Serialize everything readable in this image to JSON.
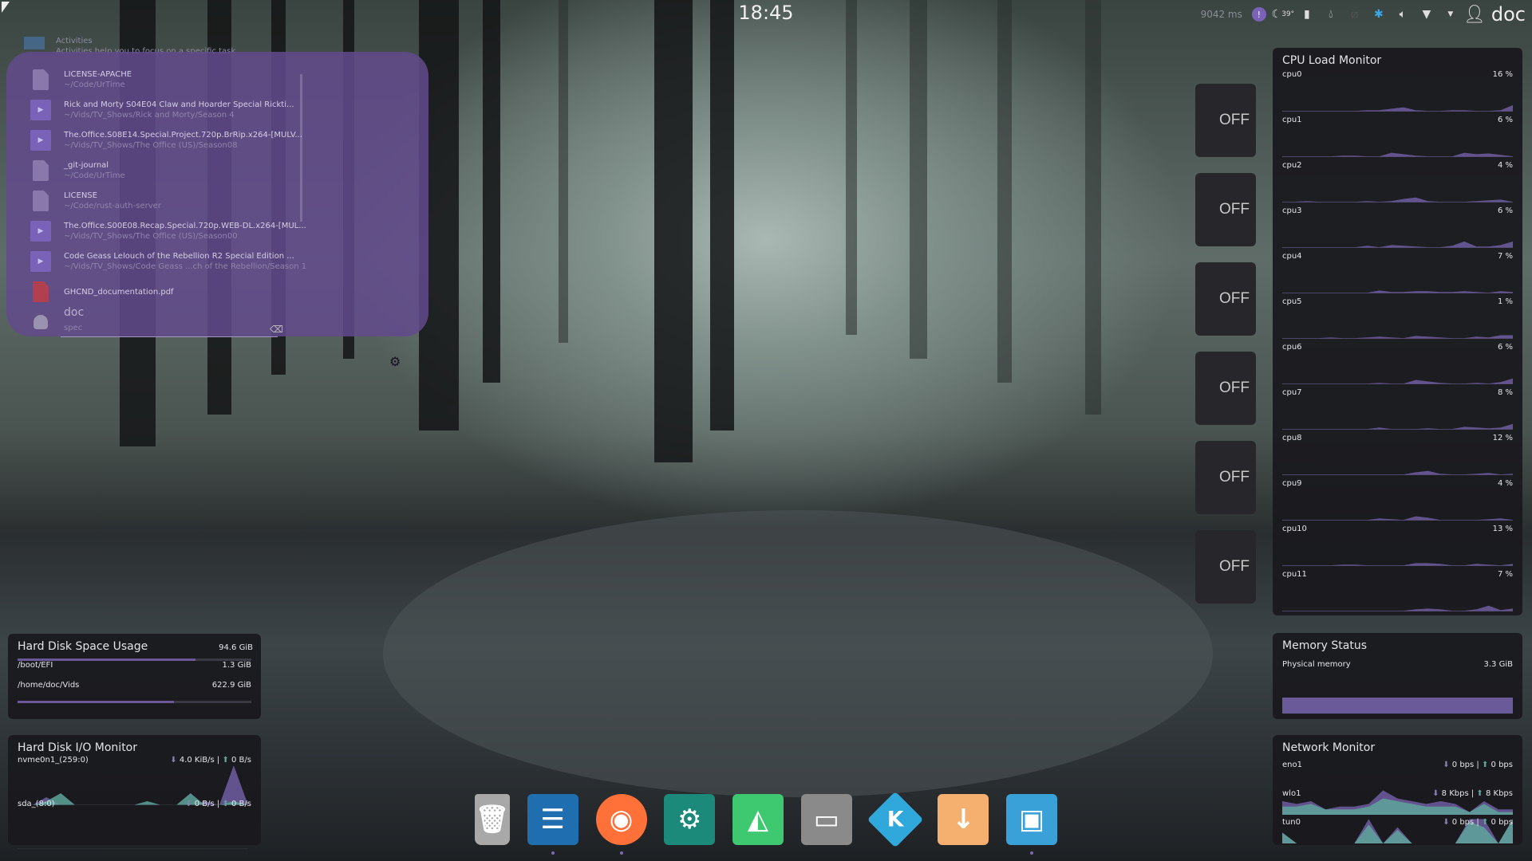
{
  "topbar": {
    "clock": "18:45",
    "latency": "9042 ms",
    "temperature": "39°",
    "user": "doc",
    "tray_icons": [
      "notification-icon",
      "weather-icon",
      "battery-icon",
      "ink-drop-icon",
      "disabled-icon",
      "bluetooth-icon",
      "volume-icon",
      "wifi-icon",
      "expand-arrow-icon",
      "user-icon"
    ]
  },
  "launcher": {
    "activities": {
      "title": "Activities",
      "subtitle": "Activities help you to focus on a specific task"
    },
    "items": [
      {
        "title": "LICENSE-APACHE",
        "path": "~/Code/UrTime",
        "type": "doc"
      },
      {
        "title": "Rick and Morty S04E04 Claw and Hoarder Special Rickti...",
        "path": "~/Vids/TV_Shows/Rick and Morty/Season 4",
        "type": "vid"
      },
      {
        "title": "The.Office.S08E14.Special.Project.720p.BrRip.x264-[MULV...",
        "path": "~/Vids/TV_Shows/The Office (US)/Season08",
        "type": "vid"
      },
      {
        "title": "_git-journal",
        "path": "~/Code/UrTime",
        "type": "doc"
      },
      {
        "title": "LICENSE",
        "path": "~/Code/rust-auth-server",
        "type": "doc"
      },
      {
        "title": "The.Office.S00E08.Recap.Special.720p.WEB-DL.x264-[MUL...",
        "path": "~/Vids/TV_Shows/The Office (US)/Season00",
        "type": "vid"
      },
      {
        "title": "Code Geass Lelouch of the Rebellion R2 Special Edition ...",
        "path": "~/Vids/TV_Shows/Code Geass ...ch of the Rebellion/Season 1",
        "type": "vid"
      },
      {
        "title": "GHCND_documentation.pdf",
        "path": "",
        "type": "pdf"
      }
    ],
    "user": "doc",
    "search_value": "spec"
  },
  "switches": [
    "OFF",
    "OFF",
    "OFF",
    "OFF",
    "OFF",
    "OFF"
  ],
  "cpu": {
    "title": "CPU Load Monitor",
    "cores": [
      {
        "name": "cpu0",
        "value": "16 %",
        "history": [
          1,
          1,
          1,
          1,
          1,
          1,
          1,
          2,
          2,
          4,
          6,
          2,
          1,
          1,
          2,
          2,
          1,
          1,
          2,
          9
        ]
      },
      {
        "name": "cpu1",
        "value": "6 %",
        "history": [
          1,
          1,
          1,
          1,
          1,
          2,
          2,
          1,
          1,
          6,
          4,
          2,
          1,
          1,
          1,
          6,
          4,
          5,
          3,
          1
        ]
      },
      {
        "name": "cpu2",
        "value": "4 %",
        "history": [
          1,
          1,
          2,
          1,
          1,
          1,
          1,
          2,
          1,
          2,
          5,
          7,
          2,
          1,
          1,
          1,
          2,
          3,
          4,
          1
        ]
      },
      {
        "name": "cpu3",
        "value": "6 %",
        "history": [
          1,
          1,
          1,
          1,
          1,
          1,
          1,
          3,
          1,
          4,
          3,
          2,
          1,
          1,
          3,
          9,
          2,
          2,
          4,
          9
        ]
      },
      {
        "name": "cpu4",
        "value": "7 %",
        "history": [
          1,
          1,
          1,
          1,
          1,
          1,
          1,
          1,
          4,
          2,
          2,
          3,
          3,
          2,
          2,
          3,
          2,
          1,
          3,
          2
        ]
      },
      {
        "name": "cpu5",
        "value": "1 %",
        "history": [
          1,
          1,
          1,
          1,
          2,
          1,
          1,
          2,
          3,
          2,
          1,
          4,
          3,
          2,
          1,
          1,
          3,
          2,
          5,
          5
        ]
      },
      {
        "name": "cpu6",
        "value": "6 %",
        "history": [
          1,
          1,
          1,
          1,
          1,
          1,
          1,
          1,
          2,
          1,
          1,
          6,
          4,
          2,
          1,
          1,
          2,
          1,
          3,
          8
        ]
      },
      {
        "name": "cpu7",
        "value": "8 %",
        "history": [
          1,
          1,
          1,
          1,
          1,
          1,
          1,
          1,
          3,
          1,
          1,
          1,
          2,
          1,
          1,
          4,
          3,
          2,
          3,
          8
        ]
      },
      {
        "name": "cpu8",
        "value": "12 %",
        "history": [
          1,
          1,
          1,
          1,
          1,
          1,
          1,
          1,
          1,
          1,
          1,
          4,
          6,
          2,
          1,
          1,
          2,
          3,
          1,
          2
        ]
      },
      {
        "name": "cpu9",
        "value": "4 %",
        "history": [
          1,
          1,
          1,
          1,
          1,
          1,
          1,
          1,
          3,
          2,
          1,
          6,
          4,
          1,
          1,
          1,
          1,
          2,
          3,
          1
        ]
      },
      {
        "name": "cpu10",
        "value": "13 %",
        "history": [
          1,
          1,
          1,
          1,
          1,
          2,
          2,
          1,
          1,
          1,
          1,
          4,
          4,
          3,
          1,
          1,
          3,
          2,
          1,
          3
        ]
      },
      {
        "name": "cpu11",
        "value": "7 %",
        "history": [
          1,
          1,
          1,
          1,
          1,
          1,
          1,
          1,
          1,
          1,
          1,
          3,
          4,
          3,
          1,
          1,
          3,
          8,
          2,
          4
        ]
      }
    ]
  },
  "memory": {
    "title": "Memory Status",
    "label": "Physical memory",
    "value": "3.3 GiB",
    "fraction": 1.0
  },
  "network": {
    "title": "Network Monitor",
    "interfaces": [
      {
        "name": "eno1",
        "down": "0 bps",
        "up": "0 bps",
        "down_hist": [
          0,
          0,
          0,
          0,
          0,
          0,
          0,
          0,
          0,
          0
        ],
        "up_hist": [
          0,
          0,
          0,
          0,
          0,
          0,
          0,
          0,
          0,
          0
        ]
      },
      {
        "name": "wlo1",
        "down": "8 Kbps",
        "up": "8 Kbps",
        "down_hist": [
          5,
          4,
          5,
          2,
          3,
          3,
          4,
          9,
          6,
          5,
          4,
          5,
          4,
          1,
          5,
          2,
          2
        ],
        "up_hist": [
          3,
          3,
          4,
          2,
          2,
          2,
          3,
          6,
          5,
          4,
          3,
          3,
          3,
          1,
          4,
          1,
          1
        ]
      },
      {
        "name": "tun0",
        "down": "0 bps",
        "up": "0 bps",
        "down_hist": [
          4,
          0,
          0,
          0,
          0,
          0,
          9,
          0,
          6,
          0,
          0,
          0,
          0,
          9,
          9,
          0,
          9
        ],
        "up_hist": [
          4,
          0,
          0,
          0,
          0,
          0,
          7,
          0,
          5,
          0,
          0,
          0,
          0,
          8,
          6,
          0,
          9
        ]
      }
    ]
  },
  "disk_space": {
    "title": "Hard Disk Space Usage",
    "total": "94.6 GiB",
    "mounts": [
      {
        "path": "/boot/EFI",
        "value": "1.3 GiB",
        "fraction": 0.76
      },
      {
        "path": "/home/doc/Vids",
        "value": "622.9 GiB",
        "fraction": 0.67
      }
    ]
  },
  "disk_io": {
    "title": "Hard Disk I/O Monitor",
    "devices": [
      {
        "name": "nvme0n1_(259:0)",
        "read": "4.0 KiB/s",
        "write": "0 B/s",
        "read_hist": [
          0,
          0,
          2,
          0,
          0,
          0,
          0,
          0,
          0,
          0,
          0,
          0,
          0,
          1,
          0,
          10,
          0
        ],
        "write_hist": [
          0,
          0,
          1,
          3,
          0,
          0,
          0,
          0,
          0,
          1,
          0,
          0,
          3,
          0,
          0,
          1,
          0
        ]
      },
      {
        "name": "sda_(8:0)",
        "read": "0 B/s",
        "write": "0 B/s",
        "read_hist": [
          0
        ],
        "write_hist": [
          0
        ]
      }
    ]
  },
  "dock": [
    {
      "name": "trash",
      "color": "#b0b0b0"
    },
    {
      "name": "notes",
      "color": "#1f6fb0"
    },
    {
      "name": "firefox",
      "color": "#ff7139"
    },
    {
      "name": "system-settings",
      "color": "#1b8a7a"
    },
    {
      "name": "system-monitor",
      "color": "#3ec870"
    },
    {
      "name": "file-archive",
      "color": "#8a8a8a"
    },
    {
      "name": "kodi",
      "color": "#30a8dc"
    },
    {
      "name": "downloader",
      "color": "#f5b070"
    },
    {
      "name": "window-manager",
      "color": "#3aa0d8"
    }
  ],
  "colors": {
    "accent": "#6a5a9a",
    "up": "#5fa59a",
    "launcher": "#624a8c"
  }
}
